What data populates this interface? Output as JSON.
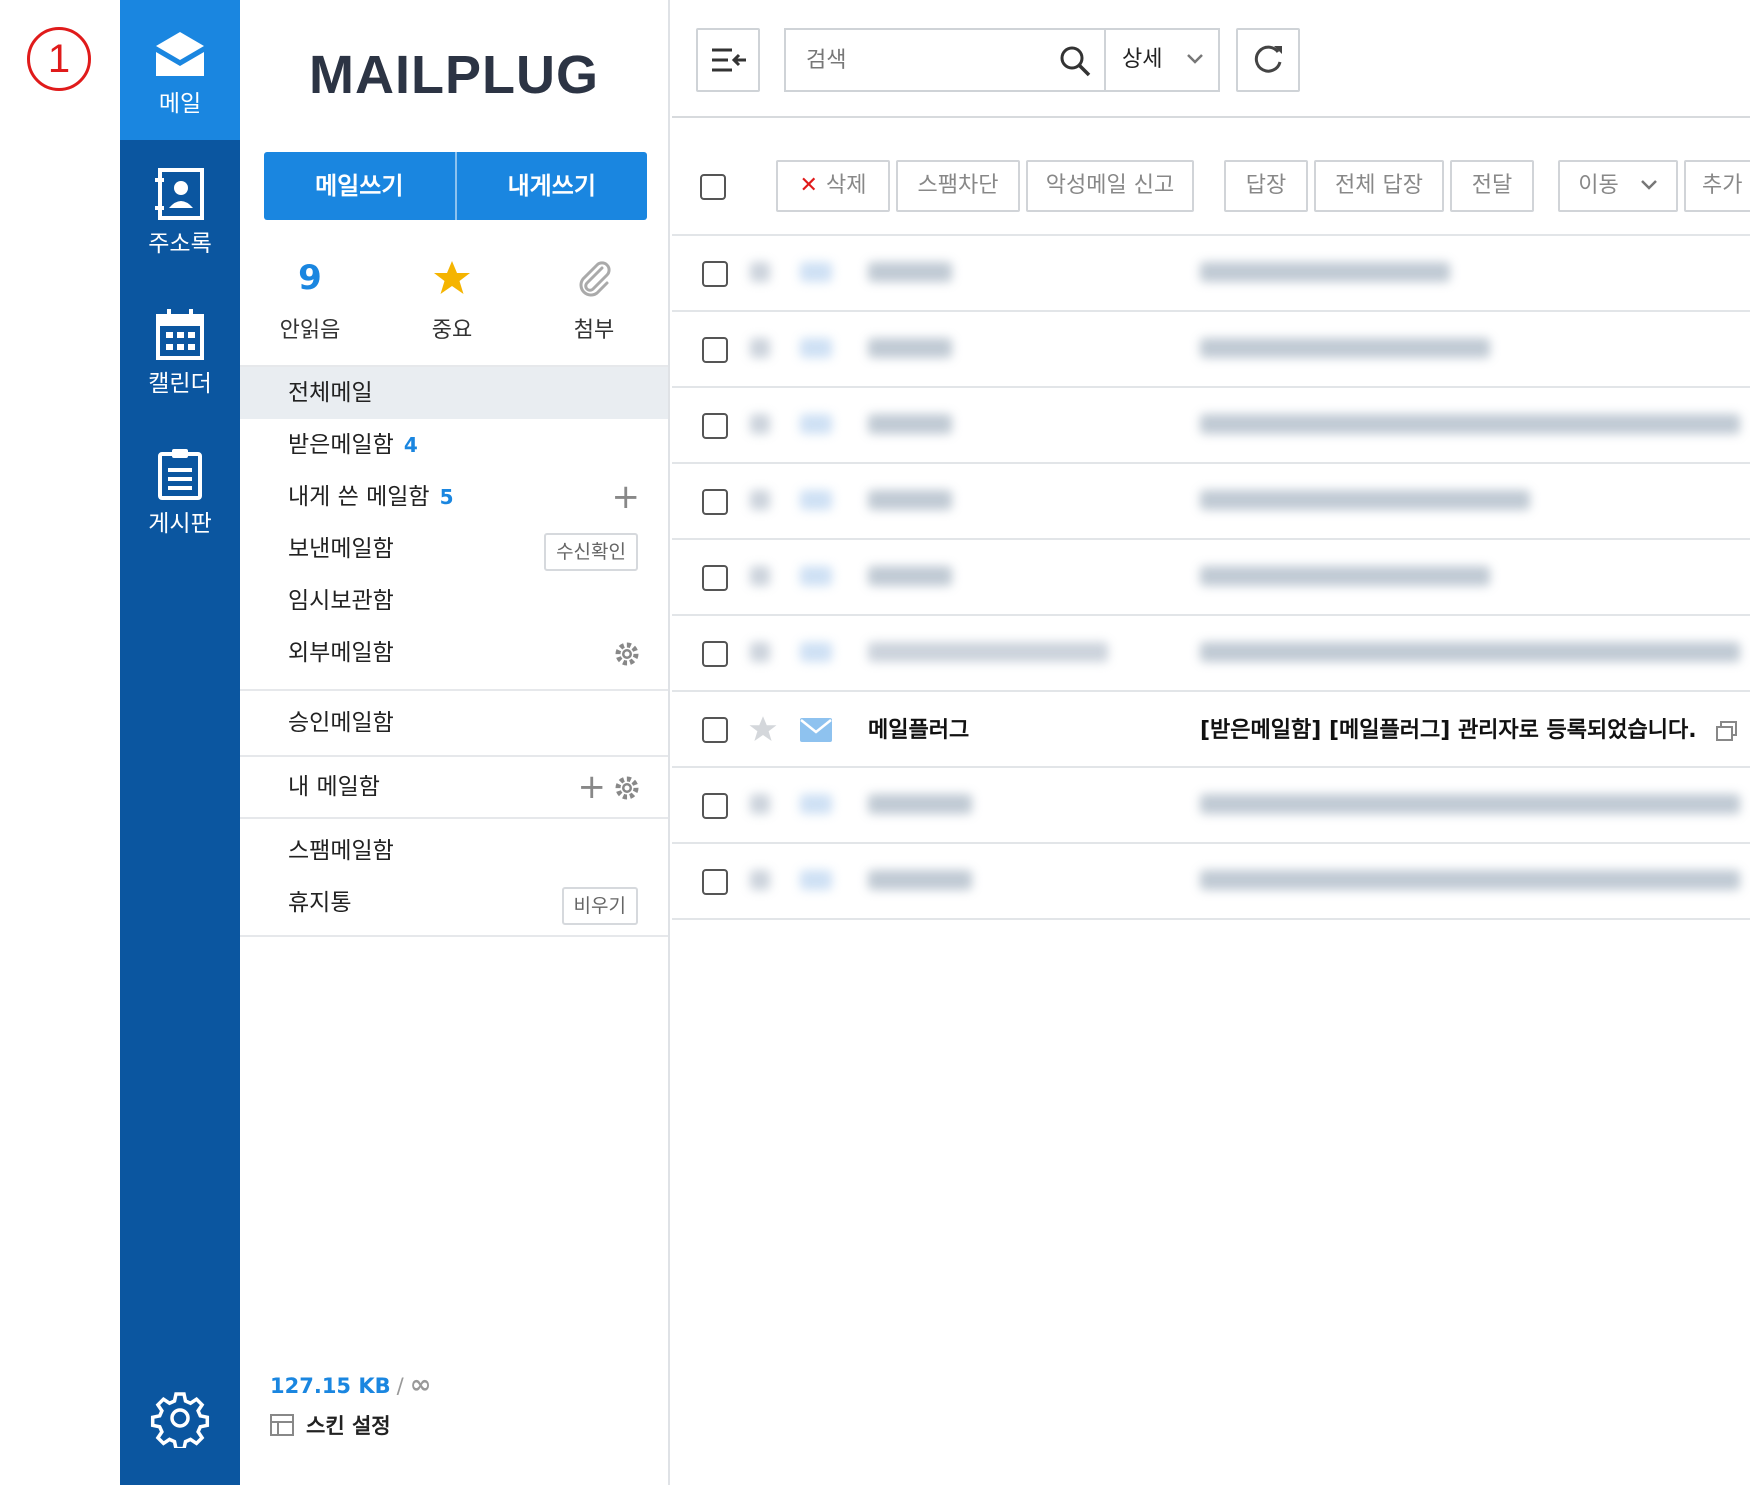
{
  "annotation": {
    "marker": "1"
  },
  "rail": {
    "items": [
      {
        "label": "메일",
        "icon": "mail-icon"
      },
      {
        "label": "주소록",
        "icon": "address-book-icon"
      },
      {
        "label": "캘린더",
        "icon": "calendar-icon"
      },
      {
        "label": "게시판",
        "icon": "board-icon"
      }
    ],
    "settings_icon": "gear-icon",
    "colors": {
      "rail": "#0b56a0",
      "active": "#1a86e0"
    }
  },
  "panel": {
    "logo": "MAILPLUG",
    "compose": {
      "write": "메일쓰기",
      "write_to_me": "내게쓰기"
    },
    "stats": {
      "unread_count": "9",
      "unread_label": "안읽음",
      "important_label": "중요",
      "attach_label": "첨부"
    },
    "folders": [
      {
        "label": "전체메일"
      },
      {
        "label": "받은메일함",
        "count": "4"
      },
      {
        "label": "내게 쓴 메일함",
        "count": "5"
      },
      {
        "label": "보낸메일함",
        "button": "수신확인"
      },
      {
        "label": "임시보관함"
      },
      {
        "label": "외부메일함"
      },
      {
        "label": "승인메일함"
      },
      {
        "label": "내 메일함"
      },
      {
        "label": "스팸메일함"
      },
      {
        "label": "휴지통",
        "button": "비우기"
      }
    ],
    "quota": {
      "used": "127.15 KB",
      "separator": "/",
      "limit": "∞"
    },
    "skin": "스킨 설정"
  },
  "toolbar": {
    "search_placeholder": "검색",
    "detail": "상세"
  },
  "actions": {
    "delete": "삭제",
    "spam_block": "스팸차단",
    "malicious_report": "악성메일 신고",
    "reply": "답장",
    "reply_all": "전체 답장",
    "forward": "전달",
    "move": "이동",
    "more": "추가"
  },
  "messages": [
    {
      "sender": "",
      "subject": "",
      "blurred": true
    },
    {
      "sender": "",
      "subject": "",
      "blurred": true
    },
    {
      "sender": "",
      "subject": "",
      "blurred": true
    },
    {
      "sender": "",
      "subject": "",
      "blurred": true
    },
    {
      "sender": "",
      "subject": "",
      "blurred": true
    },
    {
      "sender": "",
      "subject": "",
      "blurred": true
    },
    {
      "sender": "메일플러그",
      "subject": "[받은메일함] [메일플러그] 관리자로 등록되었습니다.",
      "blurred": false
    },
    {
      "sender": "",
      "subject": "",
      "blurred": true
    },
    {
      "sender": "",
      "subject": "",
      "blurred": true
    }
  ]
}
